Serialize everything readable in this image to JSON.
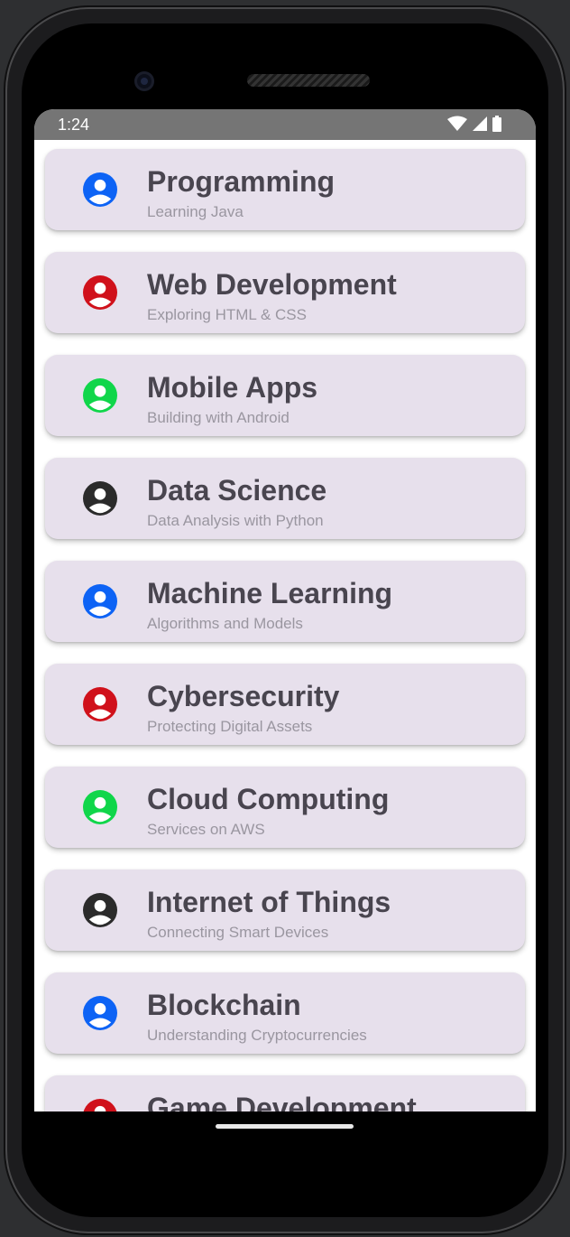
{
  "status_bar": {
    "time": "1:24"
  },
  "items": [
    {
      "title": "Programming",
      "subtitle": "Learning Java",
      "color": "#0d63f5"
    },
    {
      "title": "Web Development",
      "subtitle": "Exploring HTML & CSS",
      "color": "#d0111b"
    },
    {
      "title": "Mobile Apps",
      "subtitle": "Building with Android",
      "color": "#10d64a"
    },
    {
      "title": "Data Science",
      "subtitle": "Data Analysis with Python",
      "color": "#2b2b2b"
    },
    {
      "title": "Machine Learning",
      "subtitle": "Algorithms and Models",
      "color": "#0d63f5"
    },
    {
      "title": "Cybersecurity",
      "subtitle": "Protecting Digital Assets",
      "color": "#d0111b"
    },
    {
      "title": "Cloud Computing",
      "subtitle": "Services on AWS",
      "color": "#10d64a"
    },
    {
      "title": "Internet of Things",
      "subtitle": "Connecting Smart Devices",
      "color": "#2b2b2b"
    },
    {
      "title": "Blockchain",
      "subtitle": "Understanding Cryptocurrencies",
      "color": "#0d63f5"
    },
    {
      "title": "Game Development",
      "subtitle": "",
      "color": "#d0111b"
    }
  ]
}
